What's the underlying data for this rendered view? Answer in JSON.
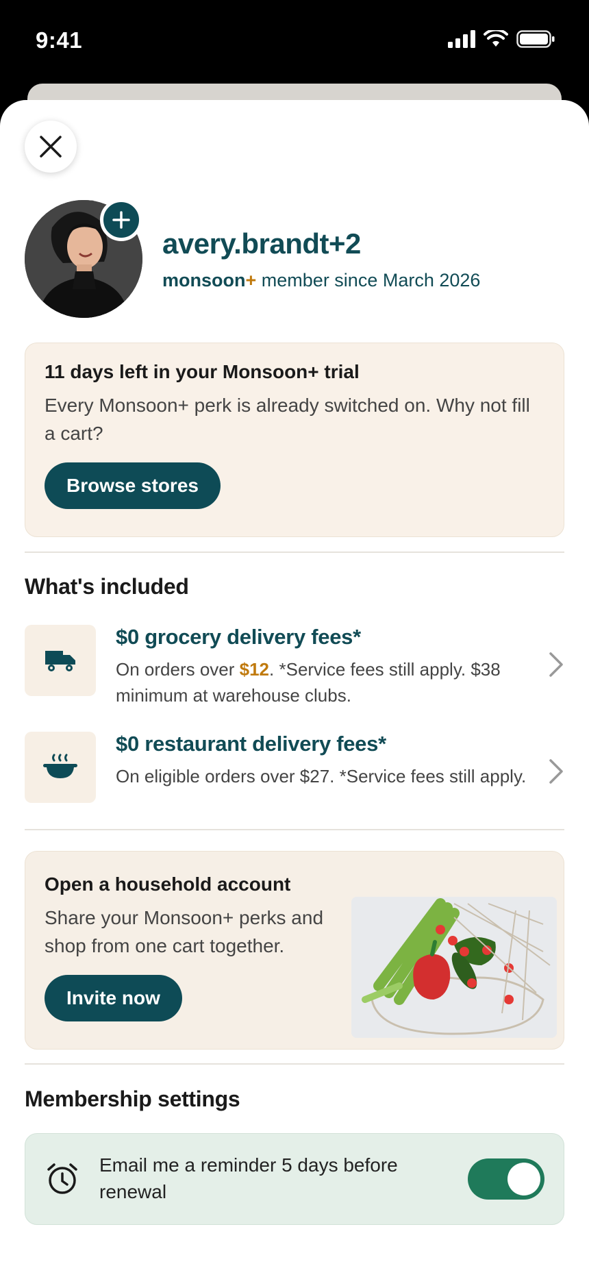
{
  "status_bar": {
    "time": "9:41"
  },
  "profile": {
    "username": "avery.brandt+2",
    "brand": "monsoon",
    "brand_plus": "+",
    "member_since": " member since March 2026"
  },
  "trial_card": {
    "title": "11 days left in your Monsoon+ trial",
    "body": "Every Monsoon+ perk is already switched on. Why not fill a cart?",
    "button_label": "Browse stores"
  },
  "included": {
    "title": "What's included",
    "perks": [
      {
        "icon": "truck-icon",
        "title": "$0 grocery delivery fees*",
        "desc_prefix": "On orders over ",
        "desc_accent": "$12",
        "desc_suffix": ". *Service fees still apply. $38 minimum at warehouse clubs."
      },
      {
        "icon": "food-bowl-icon",
        "title": "$0 restaurant delivery fees*",
        "desc": "On eligible orders over $27. *Service fees still apply."
      }
    ]
  },
  "household_card": {
    "title": "Open a household account",
    "body": "Share your Monsoon+ perks and shop from one cart together.",
    "button_label": "Invite now",
    "image": "produce-in-mesh-bag"
  },
  "settings": {
    "title": "Membership settings",
    "reminder_text": "Email me a reminder 5 days before renewal",
    "reminder_enabled": true
  },
  "colors": {
    "brand_teal": "#0e4b56",
    "accent_orange": "#c07a0e",
    "toggle_green": "#1f7a5a",
    "cream": "#f9f1e8"
  }
}
